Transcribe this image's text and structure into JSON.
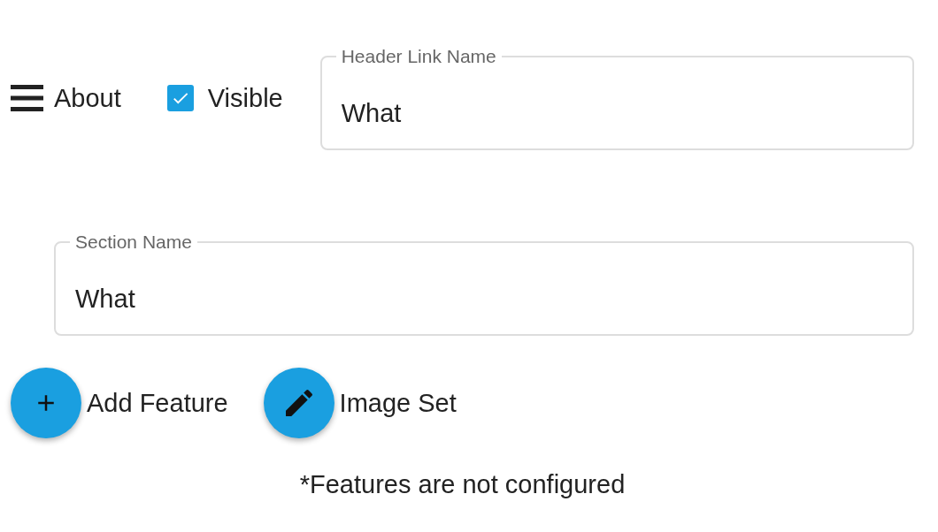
{
  "section": {
    "title": "About",
    "visible": {
      "label": "Visible",
      "checked": true
    }
  },
  "header_link_name": {
    "label": "Header Link Name",
    "value": "What"
  },
  "section_name": {
    "label": "Section Name",
    "value": "What"
  },
  "actions": [
    {
      "kind": "add",
      "label": "Add Feature"
    },
    {
      "kind": "edit",
      "label": "Image Set"
    }
  ],
  "note": "*Features are not configured"
}
